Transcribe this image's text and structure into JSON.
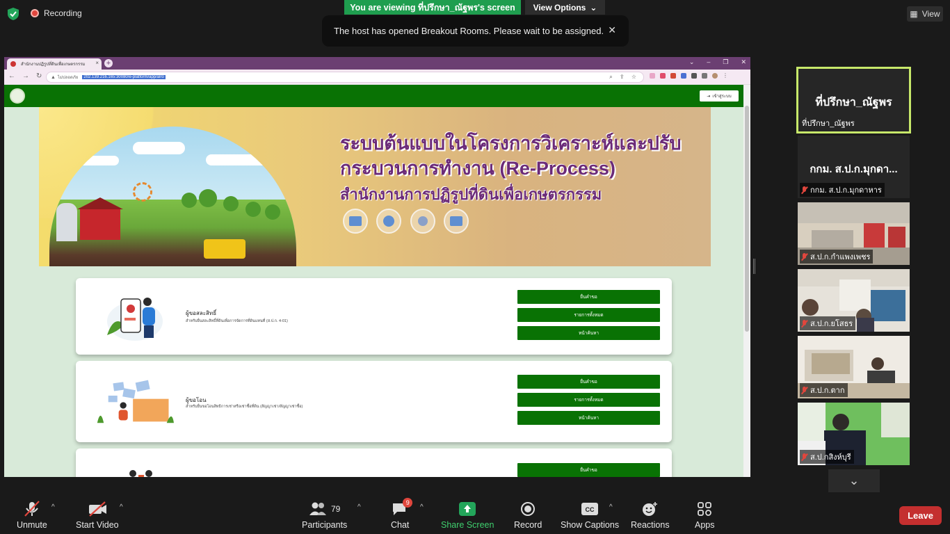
{
  "top": {
    "recording": "Recording",
    "viewing": "You are viewing ที่ปรึกษา_ณัฐพร's screen",
    "view_options": "View Options",
    "view": "View",
    "toast": "The host has opened Breakout Rooms. Please wait to be assigned."
  },
  "browser": {
    "tab_title": "สำนักงานปฏิรูปที่ดินเพื่อเกษตรกรรม",
    "not_secure": "ไม่ปลอดภัย",
    "url": "202.139.216.165:30080/e-platform/app/alro",
    "login": "เข้าสู่ระบบ"
  },
  "banner": {
    "title_line1": "ระบบต้นแบบในโครงการวิเคราะห์และปรับ",
    "title_line2": "กระบวนการทำงาน (Re-Process)",
    "subtitle": "สำนักงานการปฏิรูปที่ดินเพื่อเกษตรกรรม"
  },
  "cards": [
    {
      "title": "ผู้ขอสละสิทธิ์",
      "desc": "สำหรับยื่นสละสิทธิ์ที่ดินเพื่อการจัดการที่ดินแทนที่ (ส.ป.ก. 4-01)",
      "btn1": "ยื่นคำขอ",
      "btn2": "รายการทั้งหมด",
      "btn3": "หน้าค้นหา"
    },
    {
      "title": "ผู้ขอโอน",
      "desc": "สำหรับยื่นขอโอนสิทธิการเช่าหรือเช่าซื้อที่ดิน (สัญญาเช่า/สัญญาเช่าซื้อ)",
      "btn1": "ยื่นคำขอ",
      "btn2": "รายการทั้งหมด",
      "btn3": "หน้าค้นหา"
    },
    {
      "btn1": "ยื่นคำขอ"
    }
  ],
  "participants": {
    "active_big": "ที่ปรึกษา_ณัฐพร",
    "active_label": "ที่ปรึกษา_ณัฐพร",
    "p2_big": "กกม. ส.ป.ก.มุกดา...",
    "p2_label": "กกม. ส.ป.ก.มุกดาหาร",
    "p3_label": "ส.ป.ก.กำแพงเพชร",
    "p4_label": "ส.ป.ก.ยโสธร",
    "p5_label": "ส.ป.ก.ตาก",
    "p6_label": "ส.ป.กสิงห์บุรี"
  },
  "toolbar": {
    "unmute": "Unmute",
    "start_video": "Start Video",
    "participants": "Participants",
    "participants_count": "79",
    "chat": "Chat",
    "chat_badge": "9",
    "share_screen": "Share Screen",
    "record": "Record",
    "show_captions": "Show Captions",
    "reactions": "Reactions",
    "apps": "Apps",
    "leave": "Leave"
  },
  "colors": {
    "zoom_green": "#1f9e4f",
    "site_green": "#097204",
    "title_purple": "#6b2a78",
    "leave_red": "#c42f2f"
  }
}
